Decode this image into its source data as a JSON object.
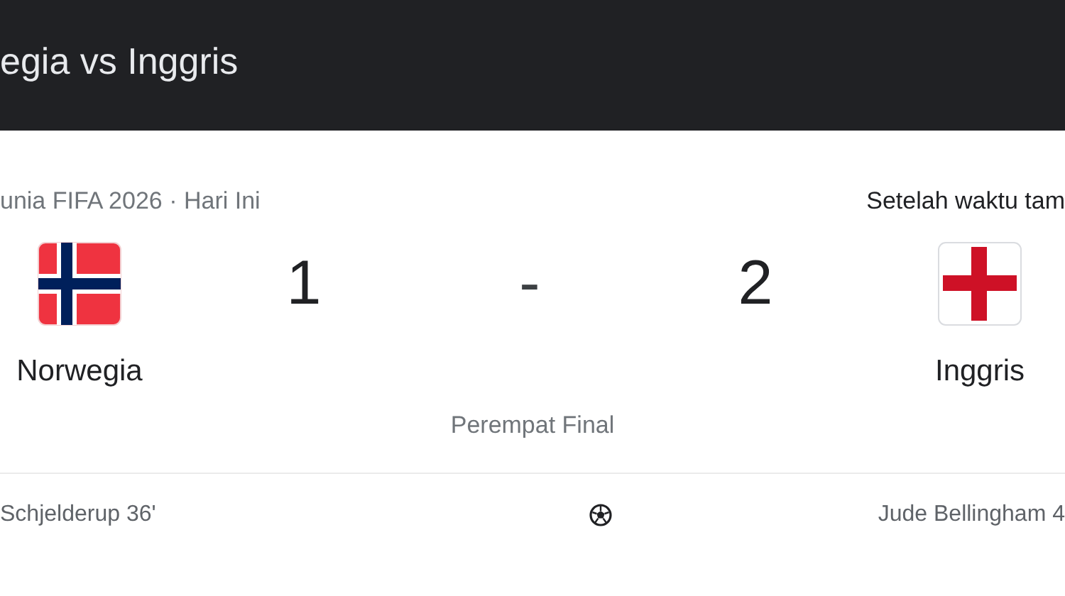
{
  "header": {
    "title": "egia vs Inggris"
  },
  "competition": "unia FIFA 2026 · Hari Ini",
  "status": "Setelah waktu tam",
  "home": {
    "name": "Norwegia",
    "score": "1"
  },
  "separator": "-",
  "away": {
    "name": "Inggris",
    "score": "2"
  },
  "stage": "Perempat Final",
  "goals": [
    {
      "home": "Schjelderup 36'",
      "away": "Jude Bellingham 4"
    }
  ]
}
